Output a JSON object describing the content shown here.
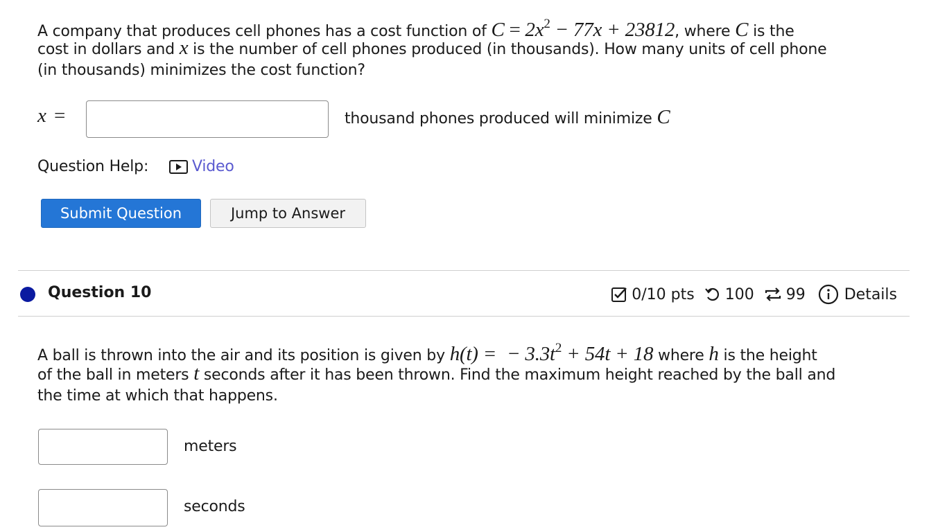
{
  "q9": {
    "prompt_1": "A company that produces cell phones has a cost function of",
    "math_C": "C",
    "math_eq": "=",
    "math_poly_a": "2x",
    "math_poly_a_exp": "2",
    "math_poly_b": "− 77x + 23812",
    "prompt_2": ", where",
    "prompt_3": "is the",
    "prompt_4": "cost in dollars and",
    "math_x": "x",
    "prompt_5": "is the number of cell phones produced (in thousands). How many units of cell phone",
    "prompt_6": "(in thousands) minimizes the cost function?",
    "answer_label_x": "x",
    "answer_label_eq": "=",
    "answer_value": "",
    "answer_suffix": "thousand phones produced will minimize",
    "answer_suffix_C": "C"
  },
  "help": {
    "label": "Question Help:",
    "video": "Video"
  },
  "buttons": {
    "submit": "Submit Question",
    "jump": "Jump to Answer"
  },
  "q10": {
    "title": "Question 10",
    "points": "0/10 pts",
    "retries": "100",
    "attempts": "99",
    "details": "Details",
    "prompt_1": "A ball is thrown into the air and its position is given by",
    "math_h": "h(t) =",
    "math_poly": "− 3.3t",
    "math_poly_exp": "2",
    "math_poly_b": "+ 54t + 18",
    "prompt_2": "where",
    "math_h2": "h",
    "prompt_3": "is the height",
    "prompt_4": "of the ball in meters",
    "math_t": "t",
    "prompt_5": "seconds after it has been thrown. Find the maximum height reached by the ball and",
    "prompt_6": "the time at which that happens.",
    "unit_meters": "meters",
    "unit_seconds": "seconds",
    "meters_value": "",
    "seconds_value": ""
  },
  "colors": {
    "accent": "#2476d6",
    "link": "#5a5ad0",
    "bullet": "#0a1aa0"
  }
}
